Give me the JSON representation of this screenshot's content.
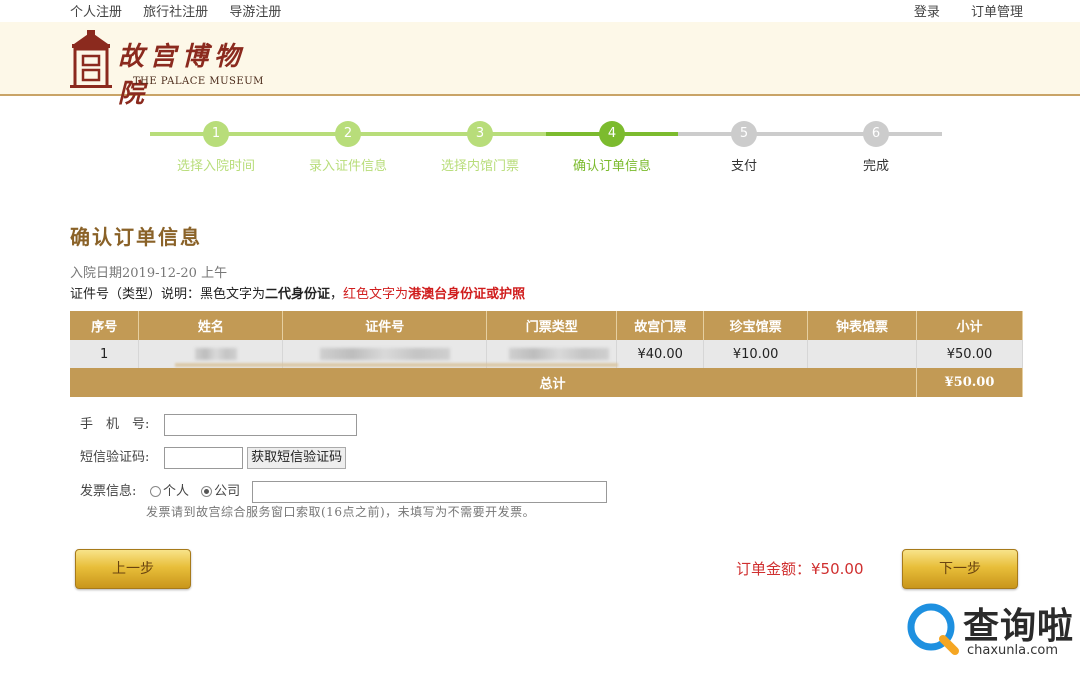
{
  "topbar": {
    "left": [
      "个人注册",
      "旅行社注册",
      "导游注册"
    ],
    "right": [
      "登录",
      "订单管理"
    ]
  },
  "logo": {
    "cn": "故宫博物院",
    "en": "THE PALACE MUSEUM"
  },
  "steps": [
    {
      "num": "1",
      "label": "选择入院时间",
      "state": "done"
    },
    {
      "num": "2",
      "label": "录入证件信息",
      "state": "done"
    },
    {
      "num": "3",
      "label": "选择内馆门票",
      "state": "done"
    },
    {
      "num": "4",
      "label": "确认订单信息",
      "state": "active"
    },
    {
      "num": "5",
      "label": "支付",
      "state": "todo"
    },
    {
      "num": "6",
      "label": "完成",
      "state": "todo"
    }
  ],
  "colors": {
    "done": "#b8dd7a",
    "active": "#7cbb2e",
    "todo": "#cccccc",
    "gold": "#c29a55",
    "red": "#d01e1e"
  },
  "page_title": "确认订单信息",
  "visit_date": "入院日期2019-12-20 上午",
  "note": {
    "prefix": "证件号（类型）说明：黑色文字为",
    "black_strong": "二代身份证",
    "sep": "，",
    "red_prefix": "红色文字为",
    "red_strong": "港澳台身份证或护照"
  },
  "table": {
    "headers": [
      "序号",
      "姓名",
      "证件号",
      "门票类型",
      "故宫门票",
      "珍宝馆票",
      "钟表馆票",
      "小计"
    ],
    "rows": [
      {
        "seq": "1",
        "palace": "¥40.00",
        "treasure": "¥10.00",
        "clock": "",
        "subtotal": "¥50.00"
      }
    ],
    "total_label": "总计",
    "total_value": "¥50.00"
  },
  "form": {
    "phone_label": "手　机　号:",
    "sms_label": "短信验证码:",
    "sms_button": "获取短信验证码",
    "invoice_label": "发票信息:",
    "radio_personal": "个人",
    "radio_company": "公司",
    "invoice_hint": "发票请到故宫综合服务窗口索取(16点之前)，未填写为不需要开发票。"
  },
  "buttons": {
    "prev": "上一步",
    "next": "下一步"
  },
  "order_amount_label": "订单金额：",
  "order_amount_value": "¥50.00",
  "watermark": {
    "brand": "查询啦",
    "url": "chaxunla.com"
  }
}
